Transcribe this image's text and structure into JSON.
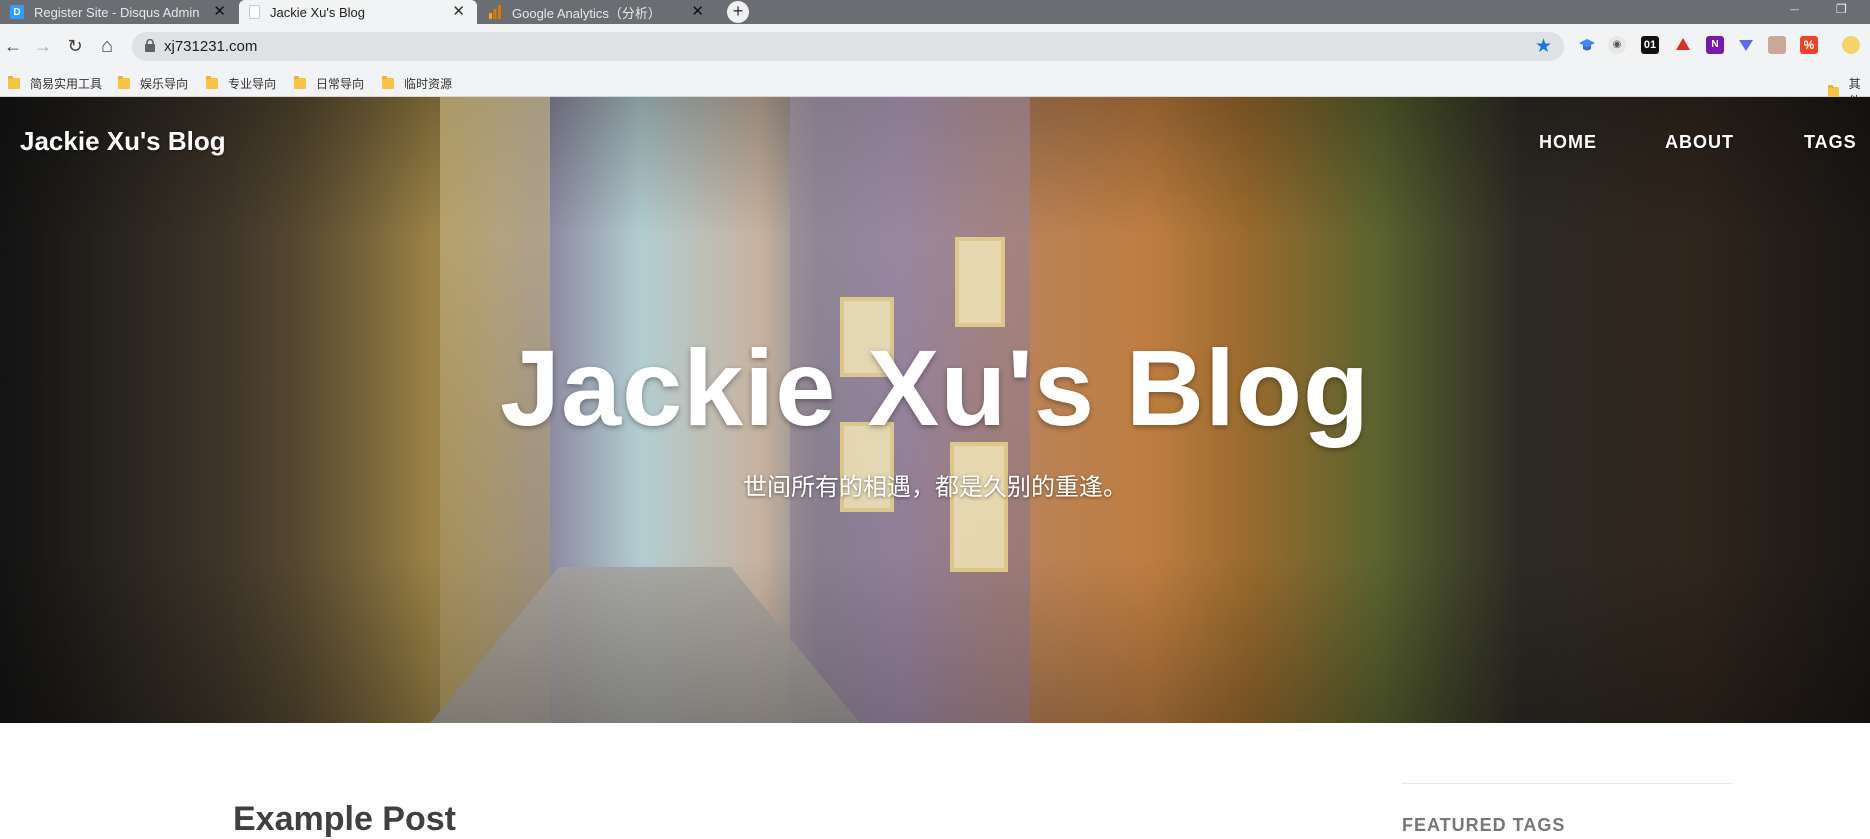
{
  "browser": {
    "tabs": [
      {
        "title": "Register Site - Disqus Admin",
        "favicon": "disqus-D-icon",
        "active": false
      },
      {
        "title": "Jackie Xu's Blog",
        "favicon": "page-icon",
        "active": true
      },
      {
        "title": "Google Analytics（分析）",
        "favicon": "analytics-icon",
        "active": false
      }
    ],
    "url": "xj731231.com",
    "bookmarks": [
      "简易实用工具",
      "娱乐导向",
      "专业导向",
      "日常导向",
      "临时资源"
    ],
    "bookmarks_overflow": "其他",
    "extensions": [
      "scholar-icon",
      "vpn-icon",
      "01-icon",
      "adblock-icon",
      "onenote-icon",
      "mail-icon",
      "pdf-icon",
      "percent-icon",
      "avatar-icon"
    ],
    "extension_text": {
      "ext_01": "01",
      "ext_n": "N",
      "ext_percent": "%"
    },
    "icons": {
      "back": "←",
      "forward": "→",
      "reload": "↻",
      "home": "⌂",
      "star": "★",
      "close": "✕",
      "newtab": "+",
      "minimize": "—",
      "restore": "❐"
    }
  },
  "site": {
    "brand": "Jackie Xu's Blog",
    "nav": [
      "HOME",
      "ABOUT",
      "TAGS"
    ],
    "hero_title": "Jackie Xu's Blog",
    "hero_subtitle": "世间所有的相遇，都是久别的重逢。",
    "post_title": "Example Post",
    "sidebar_heading": "FEATURED TAGS"
  },
  "colors": {
    "tabstrip": "#6a6d72",
    "toolbar": "#f2f3f4",
    "omnibox": "#dfe1e5",
    "accent_star": "#1a73e8",
    "hero_text": "#ffffff",
    "post_title": "#404040"
  }
}
